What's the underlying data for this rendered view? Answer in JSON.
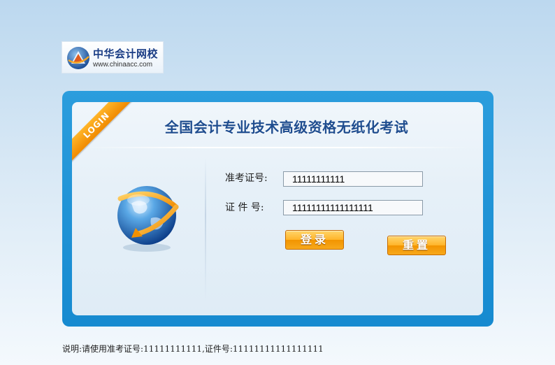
{
  "logo": {
    "name": "中华会计网校",
    "url": "www.chinaacc.com"
  },
  "ribbon": {
    "label": "LOGIN"
  },
  "header": {
    "title": "全国会计专业技术高级资格无纸化考试"
  },
  "form": {
    "exam_id_label": "准考证号:",
    "exam_id_value": "11111111111",
    "id_number_label": "证 件 号:",
    "id_number_value": "11111111111111111",
    "login_label": "登录",
    "reset_label": "重置"
  },
  "note": {
    "text": "说明:请使用准考证号:11111111111,证件号:11111111111111111"
  },
  "colors": {
    "panel_border": "#1a8fd3",
    "title_text": "#1f4d8f",
    "button_orange": "#f7a11a",
    "ribbon_orange": "#f59a10"
  },
  "icons": [
    "chinaacc-logo-icon",
    "globe-icon"
  ]
}
